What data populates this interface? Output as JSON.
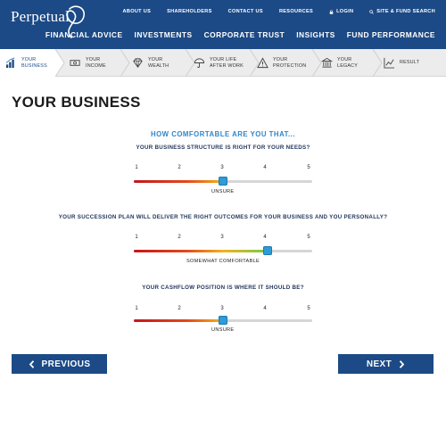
{
  "brand": {
    "logo_text": "Perpetual",
    "header_color": "#1c4a86",
    "accent_color": "#2f85c8"
  },
  "util_nav": [
    {
      "label": "ABOUT US"
    },
    {
      "label": "SHAREHOLDERS"
    },
    {
      "label": "CONTACT US"
    },
    {
      "label": "RESOURCES"
    },
    {
      "label": "LOGIN",
      "icon": "lock-icon"
    },
    {
      "label": "SITE & FUND SEARCH",
      "icon": "search-icon"
    }
  ],
  "main_nav": [
    {
      "label": "FINANCIAL ADVICE"
    },
    {
      "label": "INVESTMENTS"
    },
    {
      "label": "CORPORATE TRUST"
    },
    {
      "label": "INSIGHTS"
    },
    {
      "label": "FUND PERFORMANCE"
    }
  ],
  "steps": [
    {
      "line1": "YOUR",
      "line2": "BUSINESS",
      "icon": "bar-chart-icon",
      "active": true
    },
    {
      "line1": "YOUR",
      "line2": "INCOME",
      "icon": "money-icon",
      "active": false
    },
    {
      "line1": "YOUR",
      "line2": "WEALTH",
      "icon": "diamond-icon",
      "active": false
    },
    {
      "line1": "YOUR LIFE",
      "line2": "AFTER WORK",
      "icon": "umbrella-icon",
      "active": false
    },
    {
      "line1": "YOUR",
      "line2": "PROTECTION",
      "icon": "warning-icon",
      "active": false
    },
    {
      "line1": "YOUR",
      "line2": "LEGACY",
      "icon": "bank-icon",
      "active": false
    },
    {
      "line1": "RESULT",
      "line2": "",
      "icon": "line-chart-icon",
      "active": false
    }
  ],
  "page": {
    "title": "YOUR BUSINESS",
    "subheading": "HOW COMFORTABLE ARE YOU THAT...",
    "scale_labels": [
      "1",
      "2",
      "3",
      "4",
      "5"
    ]
  },
  "questions": [
    {
      "text": "YOUR BUSINESS STRUCTURE IS RIGHT FOR YOUR NEEDS?",
      "value": 3,
      "answer": "UNSURE"
    },
    {
      "text": "YOUR SUCCESSION PLAN WILL DELIVER THE RIGHT OUTCOMES FOR YOUR BUSINESS AND YOU PERSONALLY?",
      "value": 4,
      "answer": "SOMEWHAT COMFORTABLE"
    },
    {
      "text": "YOUR CASHFLOW POSITION IS WHERE IT SHOULD BE?",
      "value": 3,
      "answer": "UNSURE"
    }
  ],
  "buttons": {
    "previous": "PREVIOUS",
    "next": "NEXT"
  }
}
